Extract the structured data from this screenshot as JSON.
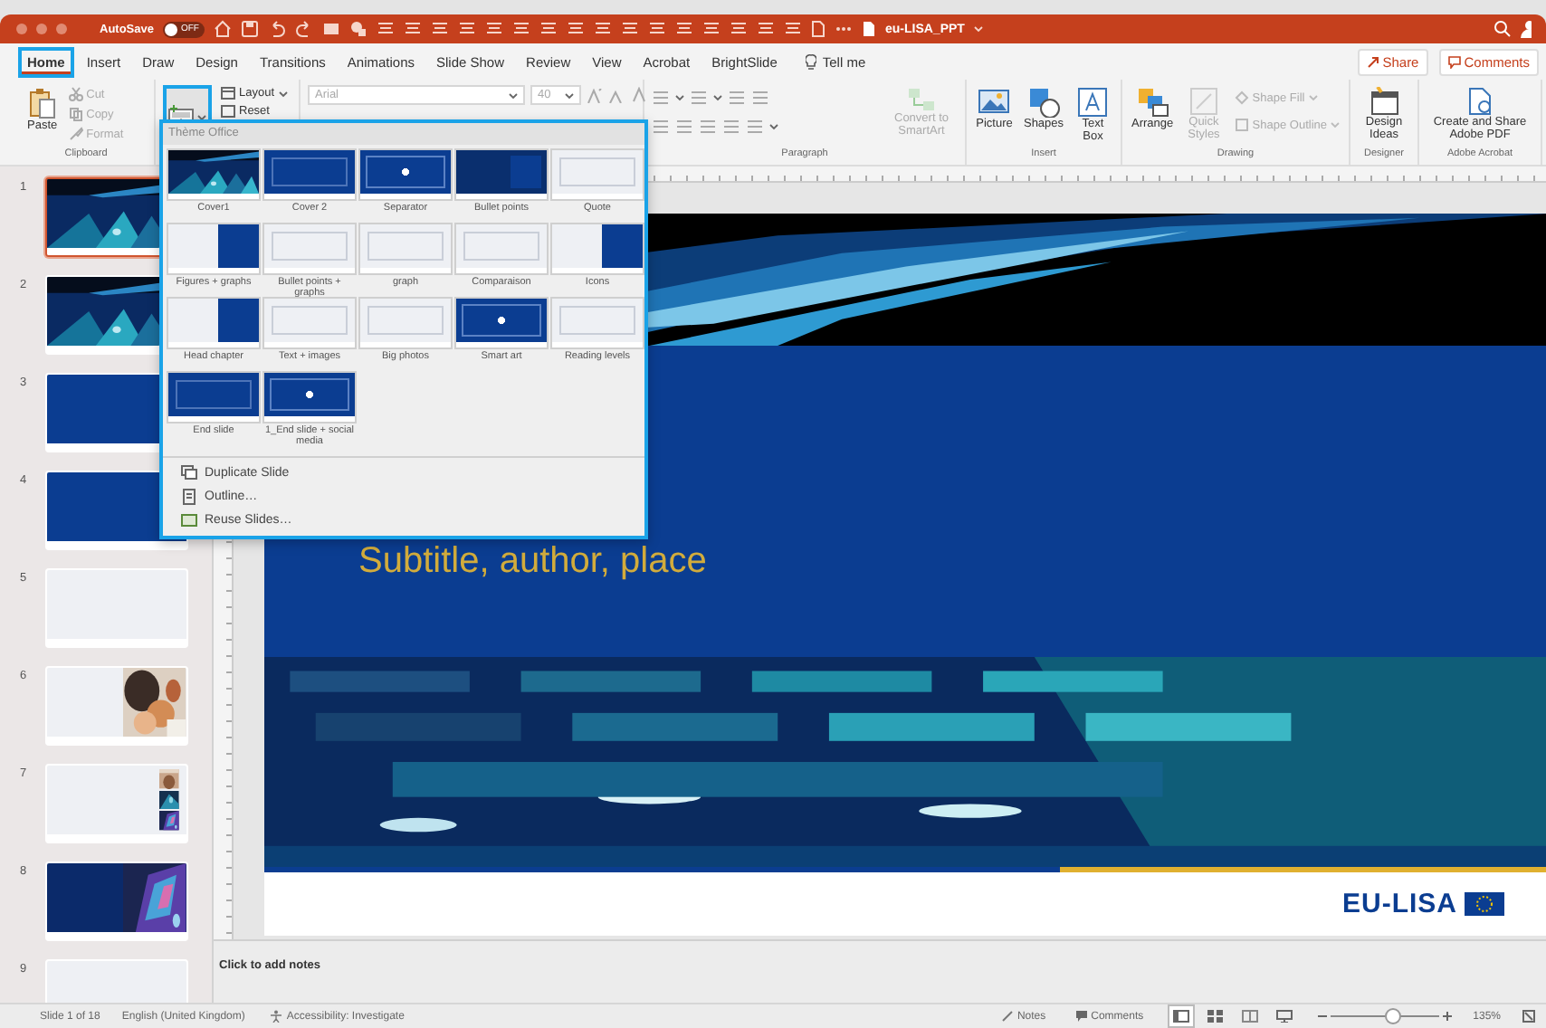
{
  "title_bar": {
    "autosave_label": "AutoSave",
    "autosave_on": false,
    "autosave_state": "OFF",
    "document_title": "eu-LISA_PPT"
  },
  "tabs": [
    {
      "label": "Home",
      "selected": true
    },
    {
      "label": "Insert",
      "selected": false
    },
    {
      "label": "Draw",
      "selected": false
    },
    {
      "label": "Design",
      "selected": false
    },
    {
      "label": "Transitions",
      "selected": false
    },
    {
      "label": "Animations",
      "selected": false
    },
    {
      "label": "Slide Show",
      "selected": false
    },
    {
      "label": "Review",
      "selected": false
    },
    {
      "label": "View",
      "selected": false
    },
    {
      "label": "Acrobat",
      "selected": false
    },
    {
      "label": "BrightSlide",
      "selected": false
    }
  ],
  "tell_me": "Tell me",
  "share_button": "Share",
  "comments_button": "Comments",
  "ribbon": {
    "clipboard": {
      "label": "Clipboard",
      "paste": "Paste",
      "items": [
        {
          "label": "Cut",
          "disabled": true
        },
        {
          "label": "Copy",
          "disabled": true
        },
        {
          "label": "Format",
          "disabled": true
        }
      ]
    },
    "slides": {
      "new_slide_expanded": true,
      "layout": "Layout",
      "reset": "Reset"
    },
    "font": {
      "name": "Arial",
      "size": "40",
      "disabled": true
    },
    "paragraph": {
      "label": "Paragraph",
      "convert": {
        "label": "Convert to SmartArt",
        "disabled": true
      }
    },
    "insert": {
      "label": "Insert",
      "items": [
        {
          "label": "Picture",
          "kind": "picture"
        },
        {
          "label": "Shapes",
          "kind": "shapes"
        },
        {
          "label": "Text Box",
          "kind": "textbox"
        }
      ]
    },
    "drawing": {
      "label": "Drawing",
      "arrange": "Arrange",
      "quick_styles": {
        "label": "Quick Styles",
        "disabled": true
      },
      "shape_fill": {
        "label": "Shape Fill",
        "disabled": true
      },
      "shape_outline": {
        "label": "Shape Outline",
        "disabled": true
      }
    },
    "designer": {
      "label": "Designer",
      "button": "Design Ideas"
    },
    "acrobat": {
      "label": "Adobe Acrobat",
      "button": "Create and Share Adobe PDF"
    }
  },
  "layout_menu": {
    "section": "Thème Office",
    "layouts": [
      {
        "name": "Cover1"
      },
      {
        "name": "Cover 2",
        "kind": "blue"
      },
      {
        "name": "Separator",
        "kind": "bluebox"
      },
      {
        "name": "Bullet points",
        "kind": "darksplit"
      },
      {
        "name": "Quote",
        "kind": "light"
      },
      {
        "name": "Figures + graphs",
        "kind": "split"
      },
      {
        "name": "Bullet points + graphs",
        "kind": "light"
      },
      {
        "name": "graph",
        "kind": "light"
      },
      {
        "name": "Comparaison",
        "kind": "light"
      },
      {
        "name": "Icons",
        "kind": "split"
      },
      {
        "name": "Head chapter",
        "kind": "split"
      },
      {
        "name": "Text + images",
        "kind": "light"
      },
      {
        "name": "Big photos",
        "kind": "light"
      },
      {
        "name": "Smart art",
        "kind": "bluebox"
      },
      {
        "name": "Reading levels",
        "kind": "light"
      },
      {
        "name": "End slide",
        "kind": "blue"
      },
      {
        "name": "1_End slide + social media",
        "kind": "bluebox"
      }
    ],
    "actions": [
      {
        "label": "Duplicate Slide",
        "kind": "duplicate"
      },
      {
        "label": "Outline…",
        "kind": "outline"
      },
      {
        "label": "Reuse Slides…",
        "kind": "reuse"
      }
    ]
  },
  "slides": [
    {
      "number": "1",
      "kind": "cover",
      "selected": true
    },
    {
      "number": "2",
      "kind": "cover",
      "selected": false
    },
    {
      "number": "3",
      "kind": "blue",
      "selected": false
    },
    {
      "number": "4",
      "kind": "blue",
      "selected": false
    },
    {
      "number": "5",
      "kind": "light",
      "selected": false
    },
    {
      "number": "6",
      "kind": "light-photo",
      "selected": false
    },
    {
      "number": "7",
      "kind": "light-stack",
      "selected": false
    },
    {
      "number": "8",
      "kind": "dark-photo",
      "selected": false
    },
    {
      "number": "9",
      "kind": "light",
      "selected": false
    }
  ],
  "slide": {
    "subtitle": "Subtitle, author, place",
    "logo": "EU-LISA"
  },
  "notes_placeholder": "Click to add notes",
  "status_bar": {
    "slide_count": "Slide 1 of 18",
    "language": "English (United Kingdom)",
    "accessibility": "Accessibility: Investigate",
    "notes": "Notes",
    "comments": "Comments",
    "views": [
      {
        "kind": "normal",
        "selected": true
      },
      {
        "kind": "sorter",
        "selected": false
      },
      {
        "kind": "reading",
        "selected": false
      },
      {
        "kind": "presenter",
        "selected": false
      }
    ],
    "zoom_slider": {
      "level": 0.58
    },
    "zoom": "135%"
  }
}
